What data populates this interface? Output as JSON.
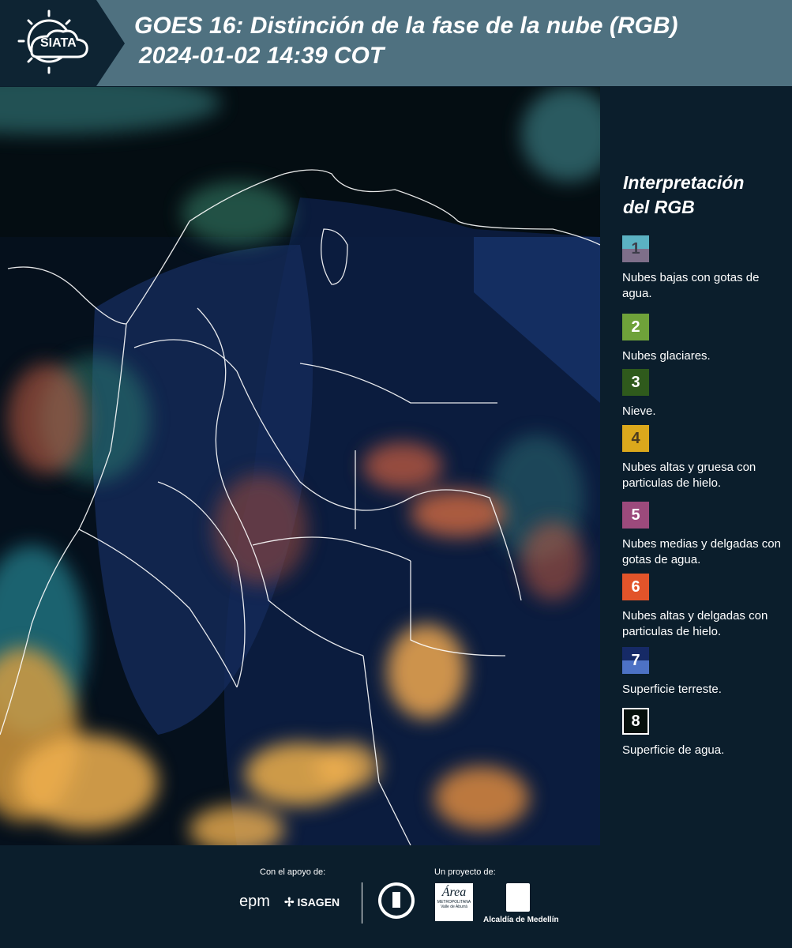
{
  "header": {
    "logo_text": "SIATA",
    "title_line1": "GOES 16: Distinción de la fase de la nube (RGB)",
    "title_line2": "2024-01-02 14:39 COT"
  },
  "legend": {
    "title_line1": "Interpretación",
    "title_line2": "del RGB",
    "items": [
      {
        "num": "1",
        "text": "Nubes bajas con gotas de agua.",
        "color_top": "#5bb2c3",
        "color_bottom": "#7e6f8a"
      },
      {
        "num": "2",
        "text": "Nubes glaciares.",
        "color": "#6fa23a"
      },
      {
        "num": "3",
        "text": "Nieve.",
        "color": "#2f5a1c"
      },
      {
        "num": "4",
        "text": "Nubes altas y gruesa con particulas de hielo.",
        "color": "#dba81c"
      },
      {
        "num": "5",
        "text": "Nubes medias y delgadas con gotas de agua.",
        "color": "#9c4a7c"
      },
      {
        "num": "6",
        "text": "Nubes altas y delgadas con particulas de hielo.",
        "color": "#e2542a"
      },
      {
        "num": "7",
        "text": "Superficie terreste.",
        "color_top": "#162a66",
        "color_bottom": "#4d72c5"
      },
      {
        "num": "8",
        "text": "Superficie de agua.",
        "color": "#06100c"
      }
    ]
  },
  "footer": {
    "support_label": "Con el apoyo de:",
    "project_label": "Un proyecto de:",
    "epm": "epm",
    "isagen": "ISAGEN",
    "area_metro": "Área",
    "area_metro_sub": "METROPOLITANA",
    "area_metro_sub2": "Valle de Aburrá",
    "alcaldia": "Alcaldía de Medellín"
  }
}
